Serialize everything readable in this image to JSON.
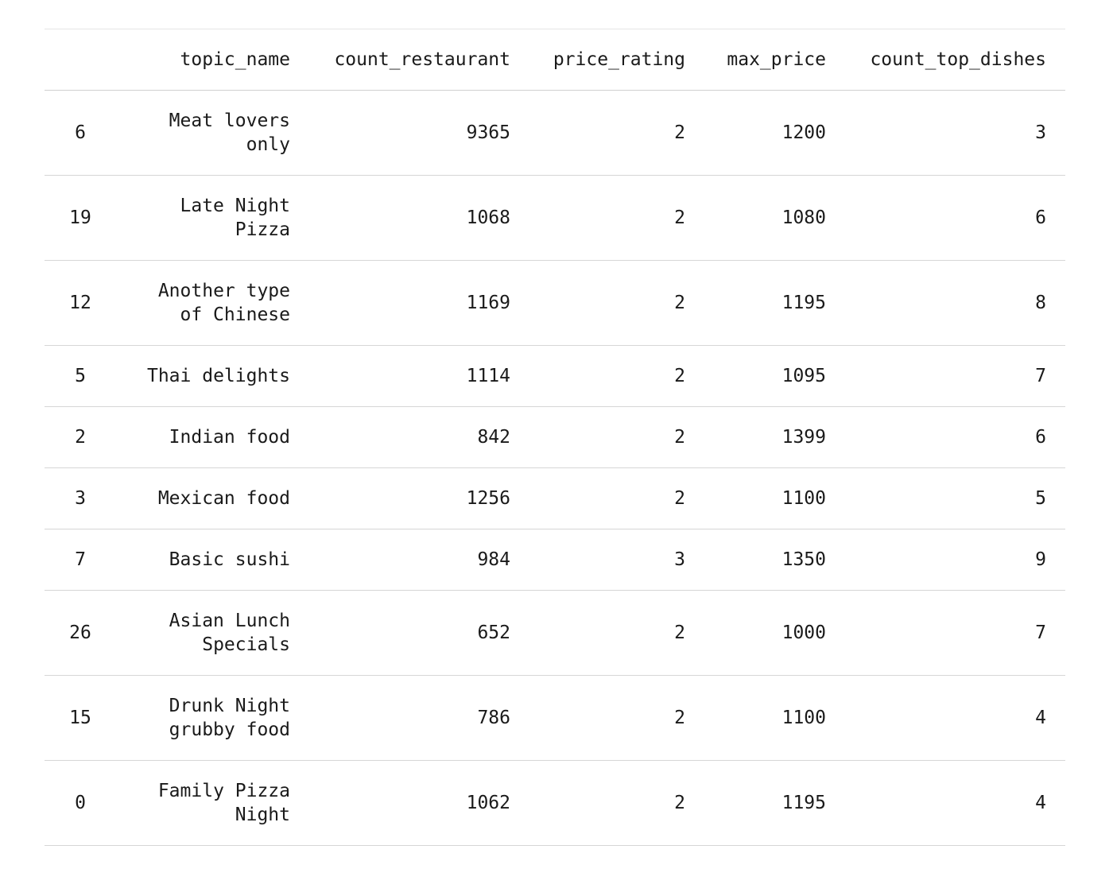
{
  "table": {
    "columns": [
      "",
      "topic_name",
      "count_restaurant",
      "price_rating",
      "max_price",
      "count_top_dishes"
    ],
    "rows": [
      {
        "index": "6",
        "topic_name": [
          "Meat lovers",
          "only"
        ],
        "count_restaurant": "9365",
        "price_rating": "2",
        "max_price": "1200",
        "count_top_dishes": "3"
      },
      {
        "index": "19",
        "topic_name": [
          "Late Night",
          "Pizza"
        ],
        "count_restaurant": "1068",
        "price_rating": "2",
        "max_price": "1080",
        "count_top_dishes": "6"
      },
      {
        "index": "12",
        "topic_name": [
          "Another type",
          "of Chinese"
        ],
        "count_restaurant": "1169",
        "price_rating": "2",
        "max_price": "1195",
        "count_top_dishes": "8"
      },
      {
        "index": "5",
        "topic_name": [
          "Thai delights"
        ],
        "count_restaurant": "1114",
        "price_rating": "2",
        "max_price": "1095",
        "count_top_dishes": "7"
      },
      {
        "index": "2",
        "topic_name": [
          "Indian food"
        ],
        "count_restaurant": "842",
        "price_rating": "2",
        "max_price": "1399",
        "count_top_dishes": "6"
      },
      {
        "index": "3",
        "topic_name": [
          "Mexican food"
        ],
        "count_restaurant": "1256",
        "price_rating": "2",
        "max_price": "1100",
        "count_top_dishes": "5"
      },
      {
        "index": "7",
        "topic_name": [
          "Basic sushi"
        ],
        "count_restaurant": "984",
        "price_rating": "3",
        "max_price": "1350",
        "count_top_dishes": "9"
      },
      {
        "index": "26",
        "topic_name": [
          "Asian Lunch",
          "Specials"
        ],
        "count_restaurant": "652",
        "price_rating": "2",
        "max_price": "1000",
        "count_top_dishes": "7"
      },
      {
        "index": "15",
        "topic_name": [
          "Drunk Night",
          "grubby food"
        ],
        "count_restaurant": "786",
        "price_rating": "2",
        "max_price": "1100",
        "count_top_dishes": "4"
      },
      {
        "index": "0",
        "topic_name": [
          "Family Pizza",
          "Night"
        ],
        "count_restaurant": "1062",
        "price_rating": "2",
        "max_price": "1195",
        "count_top_dishes": "4"
      }
    ]
  }
}
